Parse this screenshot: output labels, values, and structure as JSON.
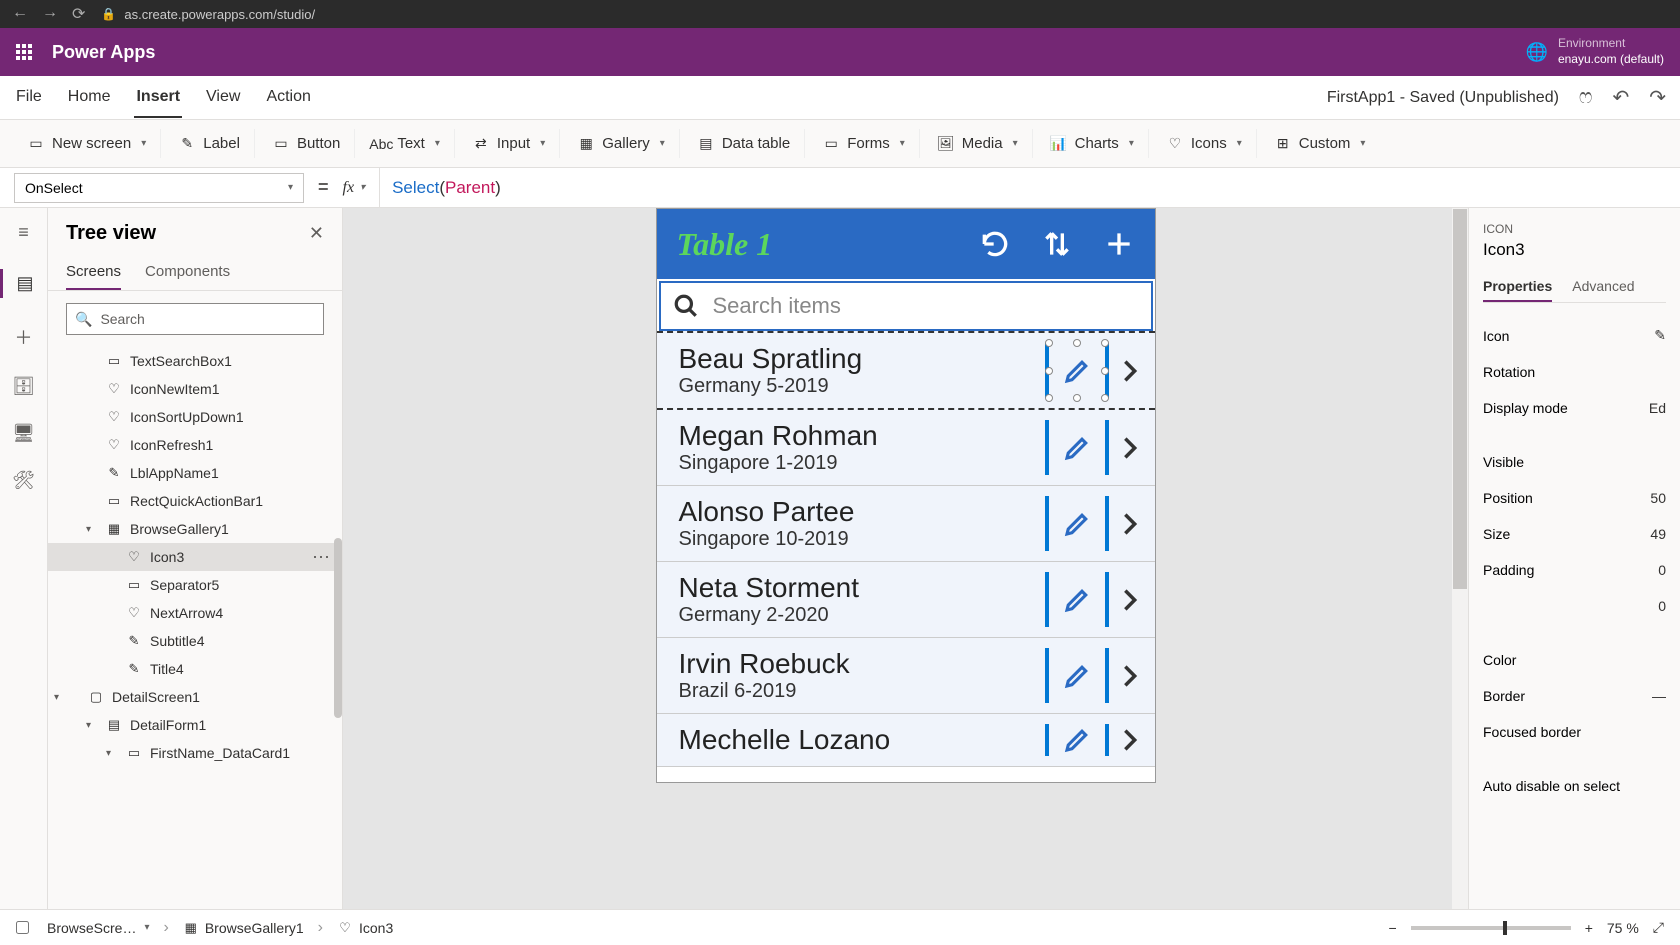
{
  "browser": {
    "url": "as.create.powerapps.com/studio/"
  },
  "header": {
    "app_name": "Power Apps",
    "env_label": "Environment",
    "env_name": "enayu.com (default)"
  },
  "menu": {
    "items": [
      "File",
      "Home",
      "Insert",
      "View",
      "Action"
    ],
    "active": "Insert",
    "status": "FirstApp1 - Saved (Unpublished)"
  },
  "ribbon": {
    "new_screen": "New screen",
    "label": "Label",
    "button": "Button",
    "text": "Text",
    "input": "Input",
    "gallery": "Gallery",
    "data_table": "Data table",
    "forms": "Forms",
    "media": "Media",
    "charts": "Charts",
    "icons": "Icons",
    "custom": "Custom"
  },
  "formula": {
    "property": "OnSelect",
    "fn": "Select",
    "arg": "Parent"
  },
  "tree": {
    "title": "Tree view",
    "tabs": {
      "screens": "Screens",
      "components": "Components"
    },
    "search_placeholder": "Search",
    "items": {
      "textsearch": "TextSearchBox1",
      "iconnew": "IconNewItem1",
      "iconsort": "IconSortUpDown1",
      "iconrefresh": "IconRefresh1",
      "lblapp": "LblAppName1",
      "rectquick": "RectQuickActionBar1",
      "browsegallery": "BrowseGallery1",
      "icon3": "Icon3",
      "separator5": "Separator5",
      "nextarrow4": "NextArrow4",
      "subtitle4": "Subtitle4",
      "title4": "Title4",
      "detailscreen": "DetailScreen1",
      "detailform": "DetailForm1",
      "firstname": "FirstName_DataCard1"
    }
  },
  "phone": {
    "title": "Table 1",
    "search_placeholder": "Search items",
    "rows": [
      {
        "title": "Beau Spratling",
        "sub": "Germany 5-2019"
      },
      {
        "title": "Megan Rohman",
        "sub": "Singapore 1-2019"
      },
      {
        "title": "Alonso Partee",
        "sub": "Singapore 10-2019"
      },
      {
        "title": "Neta Storment",
        "sub": "Germany 2-2020"
      },
      {
        "title": "Irvin Roebuck",
        "sub": "Brazil 6-2019"
      },
      {
        "title": "Mechelle Lozano",
        "sub": ""
      }
    ]
  },
  "props": {
    "category": "ICON",
    "name": "Icon3",
    "tabs": {
      "properties": "Properties",
      "advanced": "Advanced"
    },
    "rows": {
      "icon": "Icon",
      "rotation": "Rotation",
      "display_mode": "Display mode",
      "display_mode_val": "Ed",
      "visible": "Visible",
      "position": "Position",
      "position_val": "50",
      "size": "Size",
      "size_val": "49",
      "padding": "Padding",
      "padding_val1": "0",
      "padding_val2": "0",
      "color": "Color",
      "border": "Border",
      "focused_border": "Focused border",
      "auto_disable": "Auto disable on select"
    }
  },
  "bottom": {
    "crumb1": "BrowseScre…",
    "crumb2": "BrowseGallery1",
    "crumb3": "Icon3",
    "zoom": "75  %"
  }
}
